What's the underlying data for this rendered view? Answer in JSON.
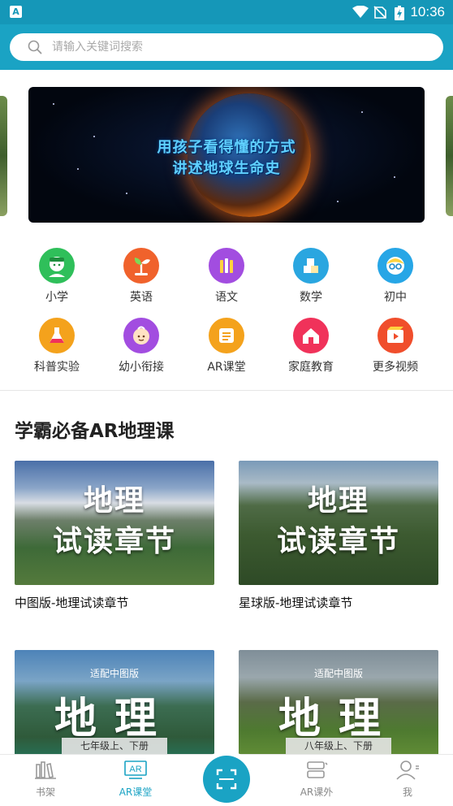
{
  "status_bar": {
    "time": "10:36",
    "app_icon_letter": "A",
    "icons": [
      "wifi-icon",
      "no-sim-icon",
      "battery-charging-icon"
    ]
  },
  "search": {
    "placeholder": "请输入关键词搜索"
  },
  "banner": {
    "line1": "用孩子看得懂的方式",
    "line2": "讲述地球生命史"
  },
  "categories": [
    {
      "label": "小学",
      "color": "#2fbf5a",
      "icon": "student-icon"
    },
    {
      "label": "英语",
      "color": "#f0622c",
      "icon": "sprout-icon"
    },
    {
      "label": "语文",
      "color": "#a24de0",
      "icon": "books-icon"
    },
    {
      "label": "数学",
      "color": "#2aa6e0",
      "icon": "blocks-icon"
    },
    {
      "label": "初中",
      "color": "#27a6e6",
      "icon": "teen-icon"
    },
    {
      "label": "科普实验",
      "color": "#f4a21c",
      "icon": "flask-icon"
    },
    {
      "label": "幼小衔接",
      "color": "#a24de0",
      "icon": "baby-icon"
    },
    {
      "label": "AR课堂",
      "color": "#f4a21c",
      "icon": "ar-book-icon"
    },
    {
      "label": "家庭教育",
      "color": "#f0325a",
      "icon": "home-icon"
    },
    {
      "label": "更多视频",
      "color": "#f04e2c",
      "icon": "video-icon"
    }
  ],
  "section": {
    "title": "学霸必备AR地理课"
  },
  "cards": [
    {
      "line1": "地理",
      "line2": "试读章节",
      "caption": "中图版-地理试读章节"
    },
    {
      "line1": "地理",
      "line2": "试读章节",
      "caption": "星球版-地理试读章节"
    },
    {
      "small": "适配中图版",
      "big": "地理",
      "grade": "七年级上、下册"
    },
    {
      "small": "适配中图版",
      "big": "地理",
      "grade": "八年级上、下册"
    }
  ],
  "bottom_nav": [
    {
      "label": "书架",
      "icon": "bookshelf-icon",
      "active": false
    },
    {
      "label": "AR课堂",
      "icon": "ar-class-icon",
      "active": true
    },
    {
      "label": "AR课外",
      "icon": "ar-extra-icon",
      "active": false
    },
    {
      "label": "我",
      "icon": "profile-icon",
      "active": false
    }
  ],
  "colors": {
    "brand": "#1aa3c4",
    "status_bar": "#1597b8"
  }
}
